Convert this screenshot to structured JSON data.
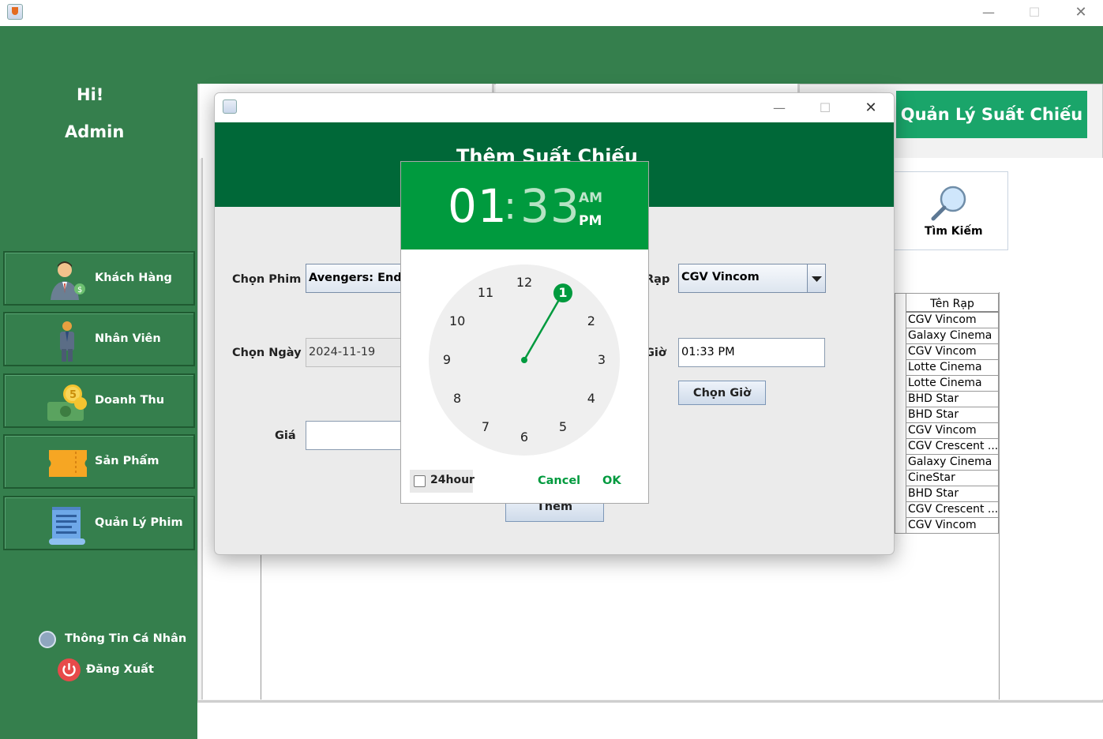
{
  "window": {
    "minimize": "—",
    "maximize": "☐",
    "close": "✕"
  },
  "greeting": {
    "hi": "Hi!",
    "user": "Admin"
  },
  "sidebar": {
    "items": [
      {
        "label": "Khách Hàng",
        "icon": "customer-icon"
      },
      {
        "label": "Nhân Viên",
        "icon": "employee-icon"
      },
      {
        "label": "Doanh Thu",
        "icon": "revenue-icon"
      },
      {
        "label": "Sản Phẩm",
        "icon": "ticket-icon"
      },
      {
        "label": "Quản Lý Phim",
        "icon": "film-list-icon"
      }
    ],
    "profile_label": "Thông Tin Cá Nhân",
    "logout_label": "Đăng Xuất"
  },
  "main": {
    "title": "Quản Lý Suất Chiếu",
    "search_label": "Tìm Kiếm",
    "table": {
      "header": "Tên Rạp",
      "rows": [
        "CGV Vincom",
        "Galaxy Cinema",
        "CGV Vincom",
        "Lotte Cinema",
        "Lotte Cinema",
        "BHD Star",
        "BHD Star",
        "CGV Vincom",
        "CGV Crescent ...",
        "Galaxy Cinema",
        "CineStar",
        "BHD Star",
        "CGV Crescent ...",
        "CGV Vincom"
      ]
    }
  },
  "dialog": {
    "heading": "Thêm Suất Chiếu",
    "film_label": "Chọn Phim",
    "film_value": "Avengers: Endga",
    "date_label": "Chọn Ngày",
    "date_value": "2024-11-19",
    "price_label": "Giá",
    "price_value": "",
    "cinema_label": "Rạp",
    "cinema_value": "CGV Vincom",
    "time_label": "Giờ",
    "time_value": "01:33 PM",
    "choose_time_button": "Chọn Giờ",
    "add_button": "Thêm"
  },
  "time_picker": {
    "hour": "01",
    "colon": ":",
    "minute": "33",
    "am": "AM",
    "pm": "PM",
    "selected_period": "PM",
    "selected_hour": 1,
    "clock_numbers": [
      "12",
      "1",
      "2",
      "3",
      "4",
      "5",
      "6",
      "7",
      "8",
      "9",
      "10",
      "11"
    ],
    "toggle_24h_label": "24hour",
    "toggle_24h_checked": false,
    "cancel_label": "Cancel",
    "ok_label": "OK",
    "accent_color": "#009a3e"
  },
  "colors": {
    "sidebar": "#357f4d",
    "title_button": "#1aa56a",
    "dialog_header": "#006838"
  }
}
